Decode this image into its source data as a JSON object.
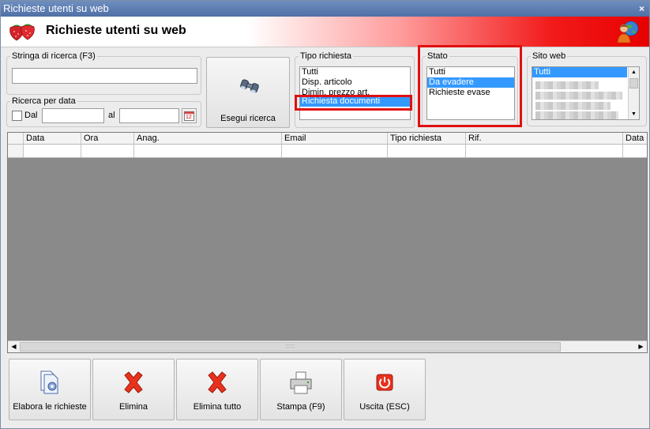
{
  "window": {
    "title": "Richieste utenti su web",
    "banner_title": "Richieste utenti su web",
    "close_glyph": "×"
  },
  "search": {
    "legend": "Stringa di ricerca (F3)",
    "value": ""
  },
  "date_filter": {
    "legend": "Ricerca per data",
    "from_label": "Dal",
    "to_label": "al",
    "from_value": "",
    "to_value": "",
    "calendar_day": "12"
  },
  "search_button": {
    "label": "Esegui ricerca",
    "icon": "binoculars-icon"
  },
  "tipo_richiesta": {
    "legend": "Tipo richiesta",
    "items": [
      "Tutti",
      "Disp. articolo",
      "Dimin. prezzo art.",
      "Richiesta documenti"
    ],
    "selected": "Richiesta documenti"
  },
  "stato": {
    "legend": "Stato",
    "items": [
      "Tutti",
      "Da evadere",
      "Richieste evase"
    ],
    "selected": "Da evadere"
  },
  "sito_web": {
    "legend": "Sito web",
    "items": [
      "Tutti"
    ],
    "selected": "Tutti"
  },
  "grid": {
    "columns": [
      "Data",
      "Ora",
      "Anag.",
      "Email",
      "Tipo richiesta",
      "Rif.",
      "Data"
    ],
    "scroll_grip": "::::::"
  },
  "toolbar": {
    "buttons": [
      {
        "label": "Elabora le richieste",
        "icon": "process-documents-icon"
      },
      {
        "label": "Elimina",
        "icon": "red-x-icon"
      },
      {
        "label": "Elimina tutto",
        "icon": "red-x-icon"
      },
      {
        "label": "Stampa (F9)",
        "icon": "printer-icon"
      },
      {
        "label": "Uscita (ESC)",
        "icon": "power-exit-icon"
      }
    ]
  },
  "colors": {
    "selection": "#3399ff",
    "highlight_border": "#e01010",
    "banner_red": "#e80000"
  }
}
